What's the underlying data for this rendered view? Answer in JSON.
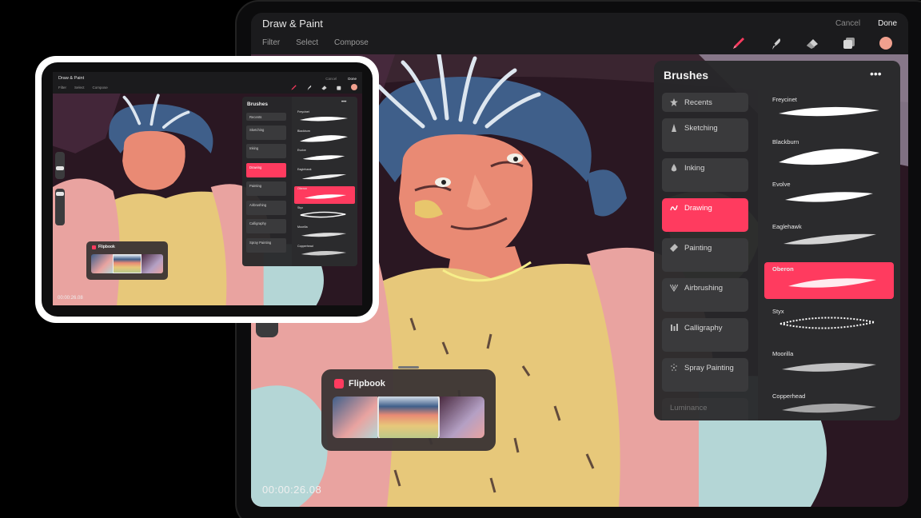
{
  "app": {
    "title": "Draw & Paint",
    "menu": [
      "Filter",
      "Select",
      "Compose"
    ],
    "cancel": "Cancel",
    "done": "Done",
    "tools": [
      "brush-icon",
      "smudge-icon",
      "eraser-icon",
      "layers-icon"
    ],
    "current_color": "#f0a08e",
    "accent": "#ff3b5f"
  },
  "brushes": {
    "title": "Brushes",
    "more": "•••",
    "categories": [
      {
        "label": "Recents",
        "icon": "star-icon"
      },
      {
        "label": "Sketching",
        "icon": "pencil-tip-icon"
      },
      {
        "label": "Inking",
        "icon": "ink-drop-icon"
      },
      {
        "label": "Drawing",
        "icon": "squiggle-icon",
        "active": true
      },
      {
        "label": "Painting",
        "icon": "paint-brush-icon"
      },
      {
        "label": "Airbrushing",
        "icon": "airbrush-icon"
      },
      {
        "label": "Calligraphy",
        "icon": "calligraphy-icon"
      },
      {
        "label": "Spray Painting",
        "icon": "spray-icon"
      },
      {
        "label": "Luminance",
        "icon": "luminance-icon"
      }
    ],
    "items": [
      {
        "name": "Freycinet"
      },
      {
        "name": "Blackburn"
      },
      {
        "name": "Evolve"
      },
      {
        "name": "Eaglehawk"
      },
      {
        "name": "Oberon",
        "active": true
      },
      {
        "name": "Styx"
      },
      {
        "name": "Moorilla"
      },
      {
        "name": "Copperhead"
      }
    ]
  },
  "flipbook": {
    "title": "Flipbook"
  },
  "timestamp": "00:00:26.08",
  "small_timestamp": "00:00:26.08"
}
